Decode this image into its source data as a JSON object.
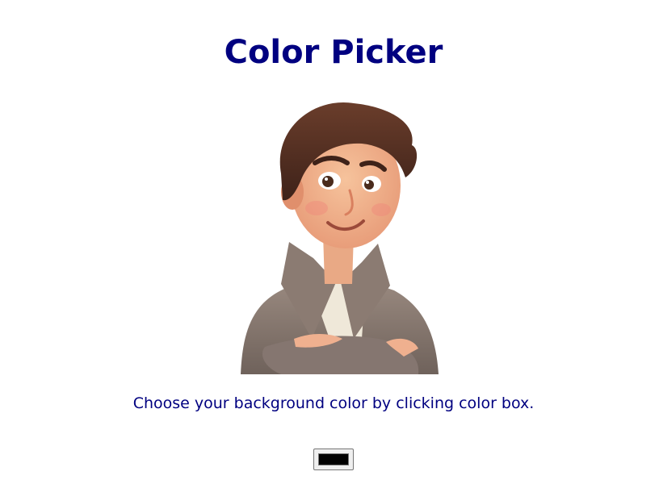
{
  "page": {
    "title": "Color Picker",
    "instructions": "Choose your background color by clicking color box."
  },
  "avatar": {
    "icon": "cartoon-man-avatar"
  },
  "color_picker": {
    "current_value": "#000000"
  }
}
